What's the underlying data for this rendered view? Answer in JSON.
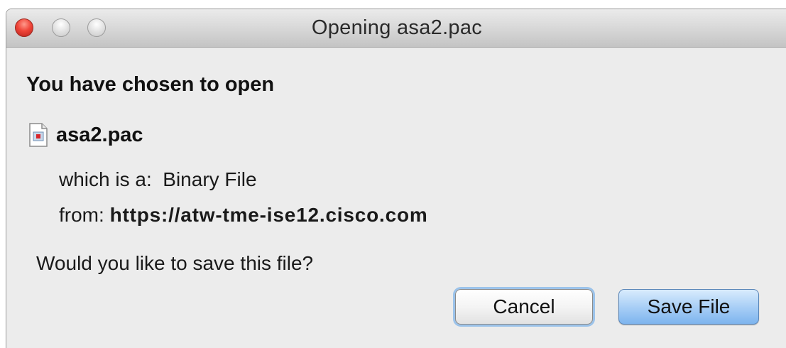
{
  "window": {
    "title": "Opening asa2.pac"
  },
  "dialog": {
    "heading": "You have chosen to open",
    "file_name": "asa2.pac",
    "file_icon": "document-icon",
    "type_label": "which is a:",
    "type_value": "Binary File",
    "from_label": "from:",
    "from_value": "https://atw-tme-ise12.cisco.com",
    "question": "Would you like to save this file?"
  },
  "buttons": {
    "cancel_label": "Cancel",
    "save_label": "Save File"
  },
  "colors": {
    "close_button": "#f0463a",
    "default_button": "#a9cff6",
    "focus_ring": "#9cc3ea",
    "window_background": "#ececec"
  }
}
